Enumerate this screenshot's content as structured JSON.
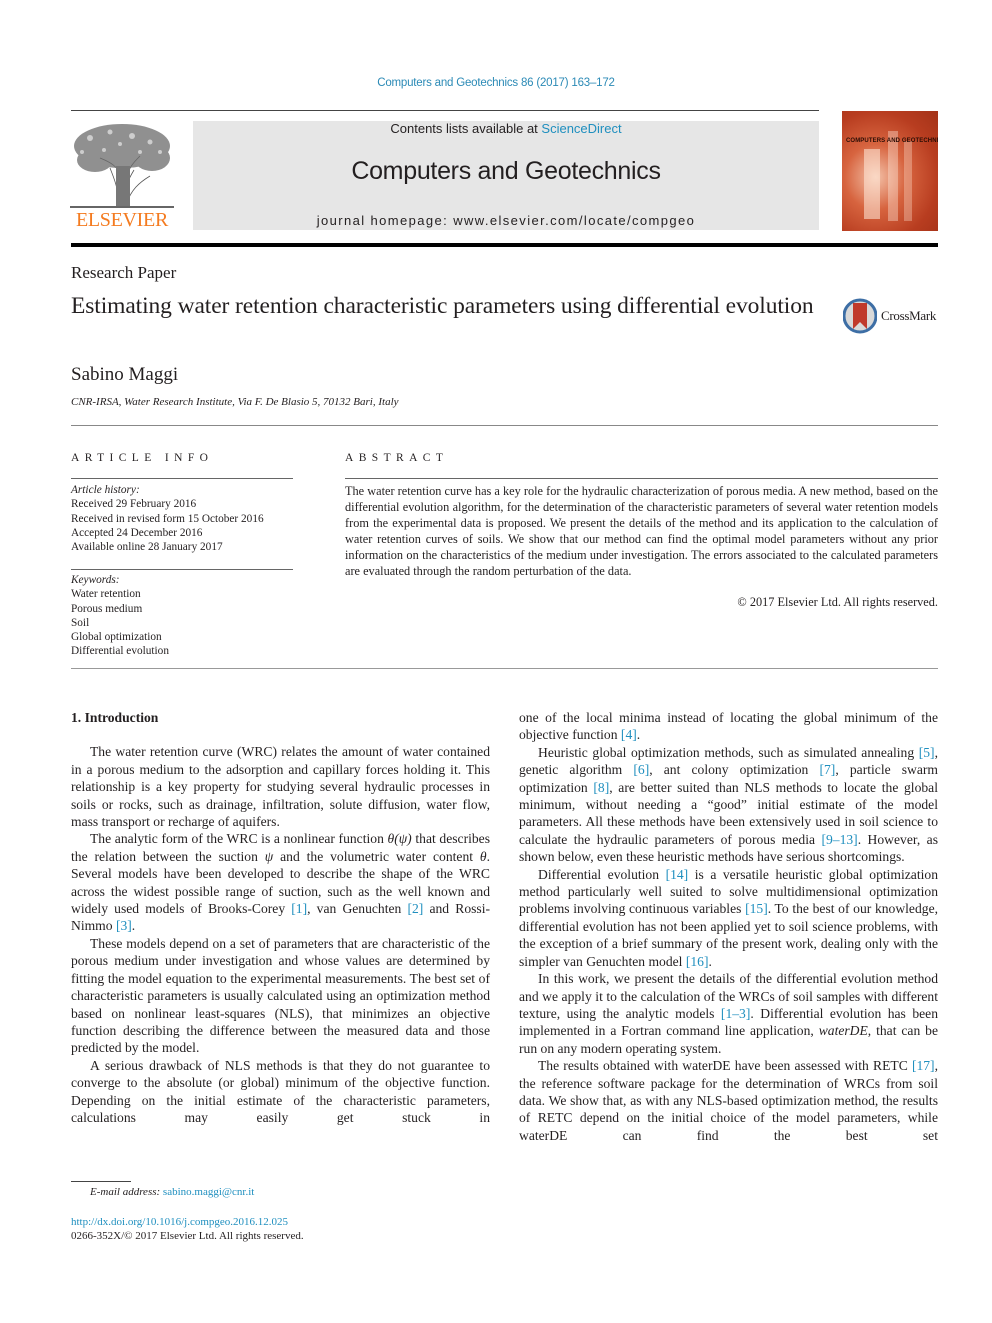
{
  "header": {
    "journal_ref": "Computers and Geotechnics 86 (2017) 163–172",
    "contents_prefix": "Contents lists available at ",
    "contents_link": "ScienceDirect",
    "journal_title": "Computers and Geotechnics",
    "homepage_prefix": "journal homepage: ",
    "homepage_url": "www.elsevier.com/locate/compgeo",
    "publisher_logo_text": "ELSEVIER",
    "cover_title": "COMPUTERS AND GEOTECHNICS",
    "colors": {
      "link": "#1f8fbf",
      "elsevier_orange": "#f47b20",
      "masthead_bg": "#e6e6e6",
      "cover_red": "#b83d20"
    }
  },
  "article": {
    "type": "Research Paper",
    "title": "Estimating water retention characteristic parameters using differential evolution",
    "crossmark_label": "CrossMark",
    "author": "Sabino Maggi",
    "affiliation": "CNR-IRSA, Water Research Institute, Via F. De Blasio 5, 70132 Bari, Italy"
  },
  "article_info": {
    "heading": "ARTICLE INFO",
    "history_label": "Article history:",
    "history": [
      "Received 29 February 2016",
      "Received in revised form 15 October 2016",
      "Accepted 24 December 2016",
      "Available online 28 January 2017"
    ],
    "keywords_label": "Keywords:",
    "keywords": [
      "Water retention",
      "Porous medium",
      "Soil",
      "Global optimization",
      "Differential evolution"
    ]
  },
  "abstract": {
    "heading": "ABSTRACT",
    "text": "The water retention curve has a key role for the hydraulic characterization of porous media. A new method, based on the differential evolution algorithm, for the determination of the characteristic parameters of several water retention models from the experimental data is proposed. We present the details of the method and its application to the calculation of water retention curves of soils. We show that our method can find the optimal model parameters without any prior information on the characteristics of the medium under investigation. The errors associated to the calculated parameters are evaluated through the random perturbation of the data.",
    "copyright": "© 2017 Elsevier Ltd. All rights reserved."
  },
  "body": {
    "section_heading": "1. Introduction",
    "left": {
      "p1": "The water retention curve (WRC) relates the amount of water contained in a porous medium to the adsorption and capillary forces holding it. This relationship is a key property for studying several hydraulic processes in soils or rocks, such as drainage, infiltration, solute diffusion, water flow, mass transport or recharge of aquifers.",
      "p2a": "The analytic form of the WRC is a nonlinear function ",
      "p2_math1": "θ(ψ)",
      "p2b": " that describes the relation between the suction ",
      "p2_math2": "ψ",
      "p2c": " and the volumetric water content ",
      "p2_math3": "θ",
      "p2d": ". Several models have been developed to describe the shape of the WRC across the widest possible range of suction, such as the well known and widely used models of Brooks-Corey ",
      "p2_ref1": "[1]",
      "p2e": ", van Genuchten ",
      "p2_ref2": "[2]",
      "p2f": " and Rossi-Nimmo ",
      "p2_ref3": "[3]",
      "p2g": ".",
      "p3": "These models depend on a set of parameters that are characteristic of the porous medium under investigation and whose values are determined by fitting the model equation to the experimental measurements. The best set of characteristic parameters is usually calculated using an optimization method based on nonlinear least-squares (NLS), that minimizes an objective function describing the difference between the measured data and those predicted by the model.",
      "p4": "A serious drawback of NLS methods is that they do not guarantee to converge to the absolute (or global) minimum of the objective function. Depending on the initial estimate of the characteristic parameters, calculations may easily get stuck in"
    },
    "right": {
      "p1a": "one of the local minima instead of locating the global minimum of the objective function ",
      "p1_ref": "[4]",
      "p1b": ".",
      "p2a": "Heuristic global optimization methods, such as simulated annealing ",
      "p2_ref5": "[5]",
      "p2b": ", genetic algorithm ",
      "p2_ref6": "[6]",
      "p2c": ", ant colony optimization ",
      "p2_ref7": "[7]",
      "p2d": ", particle swarm optimization ",
      "p2_ref8": "[8]",
      "p2e": ", are better suited than NLS methods to locate the global minimum, without needing a “good” initial estimate of the model parameters. All these methods have been extensively used in soil science to calculate the hydraulic parameters of porous media ",
      "p2_ref9": "[9–13]",
      "p2f": ". However, as shown below, even these heuristic methods have serious shortcomings.",
      "p3a": "Differential evolution ",
      "p3_ref14": "[14]",
      "p3b": " is a versatile heuristic global optimization method particularly well suited to solve multidimensional optimization problems involving continuous variables ",
      "p3_ref15": "[15]",
      "p3c": ". To the best of our knowledge, differential evolution has not been applied yet to soil science problems, with the exception of a brief summary of the present work, dealing only with the simpler van Genuchten model ",
      "p3_ref16": "[16]",
      "p3d": ".",
      "p4a": "In this work, we present the details of the differential evolution method and we apply it to the calculation of the WRCs of soil samples with different texture, using the analytic models ",
      "p4_ref": "[1–3]",
      "p4b": ". Differential evolution has been implemented in a Fortran command line application, ",
      "p4_ital": "waterDE",
      "p4c": ", that can be run on any modern operating system.",
      "p5a": "The results obtained with waterDE have been assessed with RETC ",
      "p5_ref": "[17]",
      "p5b": ", the reference software package for the determination of WRCs from soil data. We show that, as with any NLS-based optimization method, the results of RETC depend on the initial choice of the model parameters, while waterDE can find the best set"
    }
  },
  "footer": {
    "email_label": "E-mail address: ",
    "email": "sabino.maggi@cnr.it",
    "doi": "http://dx.doi.org/10.1016/j.compgeo.2016.12.025",
    "issn": "0266-352X/© 2017 Elsevier Ltd. All rights reserved."
  }
}
